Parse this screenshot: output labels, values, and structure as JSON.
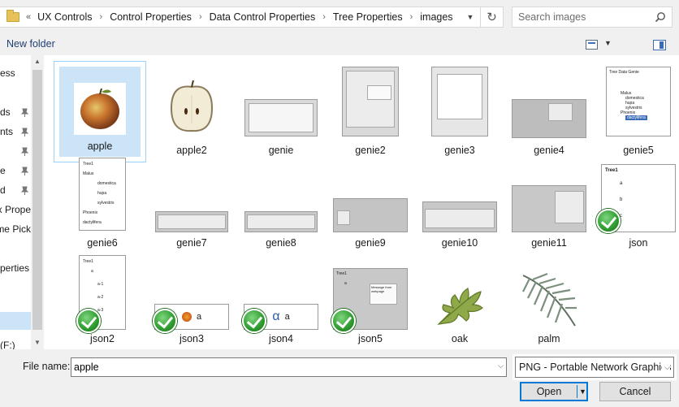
{
  "address": {
    "overflow_chevron": "«",
    "crumbs": [
      "UX Controls",
      "Control Properties",
      "Data Control Properties",
      "Tree Properties",
      "images"
    ],
    "refresh_icon": "refresh-icon"
  },
  "search": {
    "placeholder": "Search images",
    "icon": "search-icon"
  },
  "toolbar": {
    "new_folder": "New folder"
  },
  "sidebar": {
    "items": [
      "ess",
      "ds",
      "nts",
      "",
      "e",
      "d",
      "x Prope",
      "me Pick",
      "",
      "perties",
      "",
      "(F:)"
    ]
  },
  "files": [
    {
      "name": "apple",
      "selected": true
    },
    {
      "name": "apple2"
    },
    {
      "name": "genie"
    },
    {
      "name": "genie2"
    },
    {
      "name": "genie3"
    },
    {
      "name": "genie4"
    },
    {
      "name": "genie5",
      "thumb_title": "Tree Data Genie",
      "thumb_rows": [
        "Malus",
        "domestica",
        "hupa",
        "sylvestris",
        "Phoenix",
        "dactylifera"
      ]
    },
    {
      "name": "genie6",
      "thumb_title": "Tree1",
      "thumb_rows": [
        "Malus",
        "domestica",
        "hupa",
        "sylvestris",
        "Phoenix",
        "dactylifera"
      ]
    },
    {
      "name": "genie7"
    },
    {
      "name": "genie8"
    },
    {
      "name": "genie9"
    },
    {
      "name": "genie10"
    },
    {
      "name": "genie11"
    },
    {
      "name": "json",
      "thumb_title": "Tree1",
      "thumb_rows": [
        "a",
        "b",
        "c"
      ]
    },
    {
      "name": "json2",
      "thumb_title": "Tree1",
      "thumb_rows": [
        "a",
        "a-1",
        "a-2",
        "a-3"
      ]
    },
    {
      "name": "json3",
      "thumb_text": "a"
    },
    {
      "name": "json4",
      "thumb_text": "a",
      "thumb_glyph": "α"
    },
    {
      "name": "json5",
      "thumb_title": "Tree1",
      "thumb_rows": [
        "a"
      ],
      "thumb_dialog": "Message from webpage"
    },
    {
      "name": "oak"
    },
    {
      "name": "palm"
    }
  ],
  "bottom": {
    "file_name_label": "File name:",
    "file_name_value": "apple",
    "file_type": "PNG - Portable Network Graphics",
    "open_label": "Open",
    "cancel_label": "Cancel"
  }
}
